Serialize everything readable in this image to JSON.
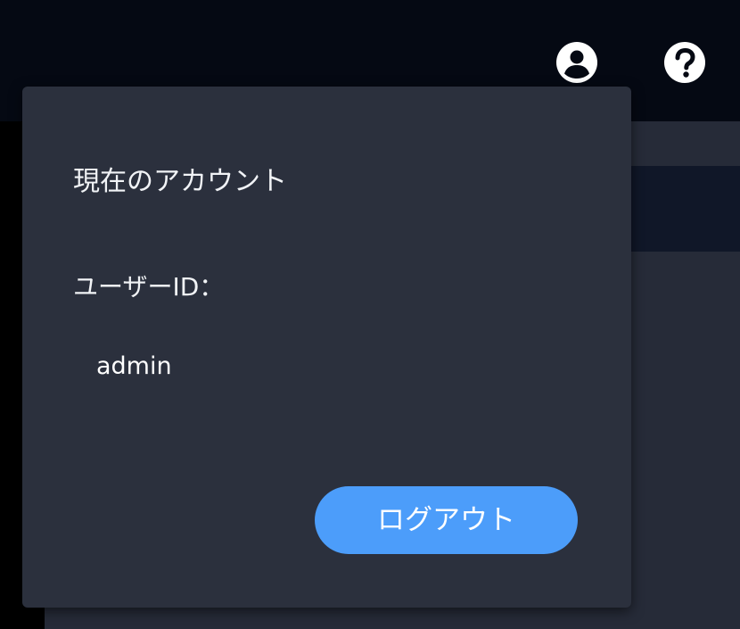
{
  "header": {
    "icons": {
      "account": "account-circle-icon",
      "help": "help-circle-icon"
    }
  },
  "account_popover": {
    "title": "現在のアカウント",
    "user_id_label": "ユーザーID：",
    "user_id_value": "admin",
    "logout_label": "ログアウト"
  },
  "colors": {
    "topbar_bg": "#050913",
    "popover_bg": "#2b303d",
    "content_bg": "#262b38",
    "content_band": "#101728",
    "accent": "#4c9dfa",
    "text": "#f1f3f6"
  }
}
